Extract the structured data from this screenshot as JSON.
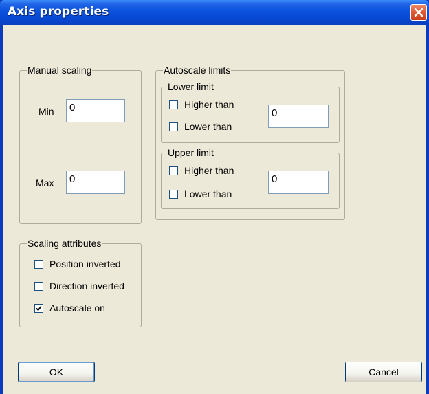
{
  "window": {
    "title": "Axis properties"
  },
  "manual_scaling": {
    "legend": "Manual scaling",
    "min_label": "Min",
    "min_value": "0",
    "max_label": "Max",
    "max_value": "0"
  },
  "autoscale_limits": {
    "legend": "Autoscale limits",
    "lower": {
      "legend": "Lower limit",
      "higher_than_label": "Higher than",
      "higher_than_checked": false,
      "lower_than_label": "Lower than",
      "lower_than_checked": false,
      "value": "0"
    },
    "upper": {
      "legend": "Upper limit",
      "higher_than_label": "Higher than",
      "higher_than_checked": false,
      "lower_than_label": "Lower than",
      "lower_than_checked": false,
      "value": "0"
    }
  },
  "scaling_attributes": {
    "legend": "Scaling attributes",
    "position_inverted_label": "Position inverted",
    "position_inverted_checked": false,
    "direction_inverted_label": "Direction inverted",
    "direction_inverted_checked": false,
    "autoscale_on_label": "Autoscale on",
    "autoscale_on_checked": true
  },
  "buttons": {
    "ok": "OK",
    "cancel": "Cancel"
  },
  "colors": {
    "title_bar": "#0a52dd",
    "dialog_bg": "#ece9d8",
    "close_button": "#e25d37",
    "field_border": "#7f9db9"
  },
  "icons": {
    "close": "close-icon",
    "check": "checkmark-icon"
  }
}
